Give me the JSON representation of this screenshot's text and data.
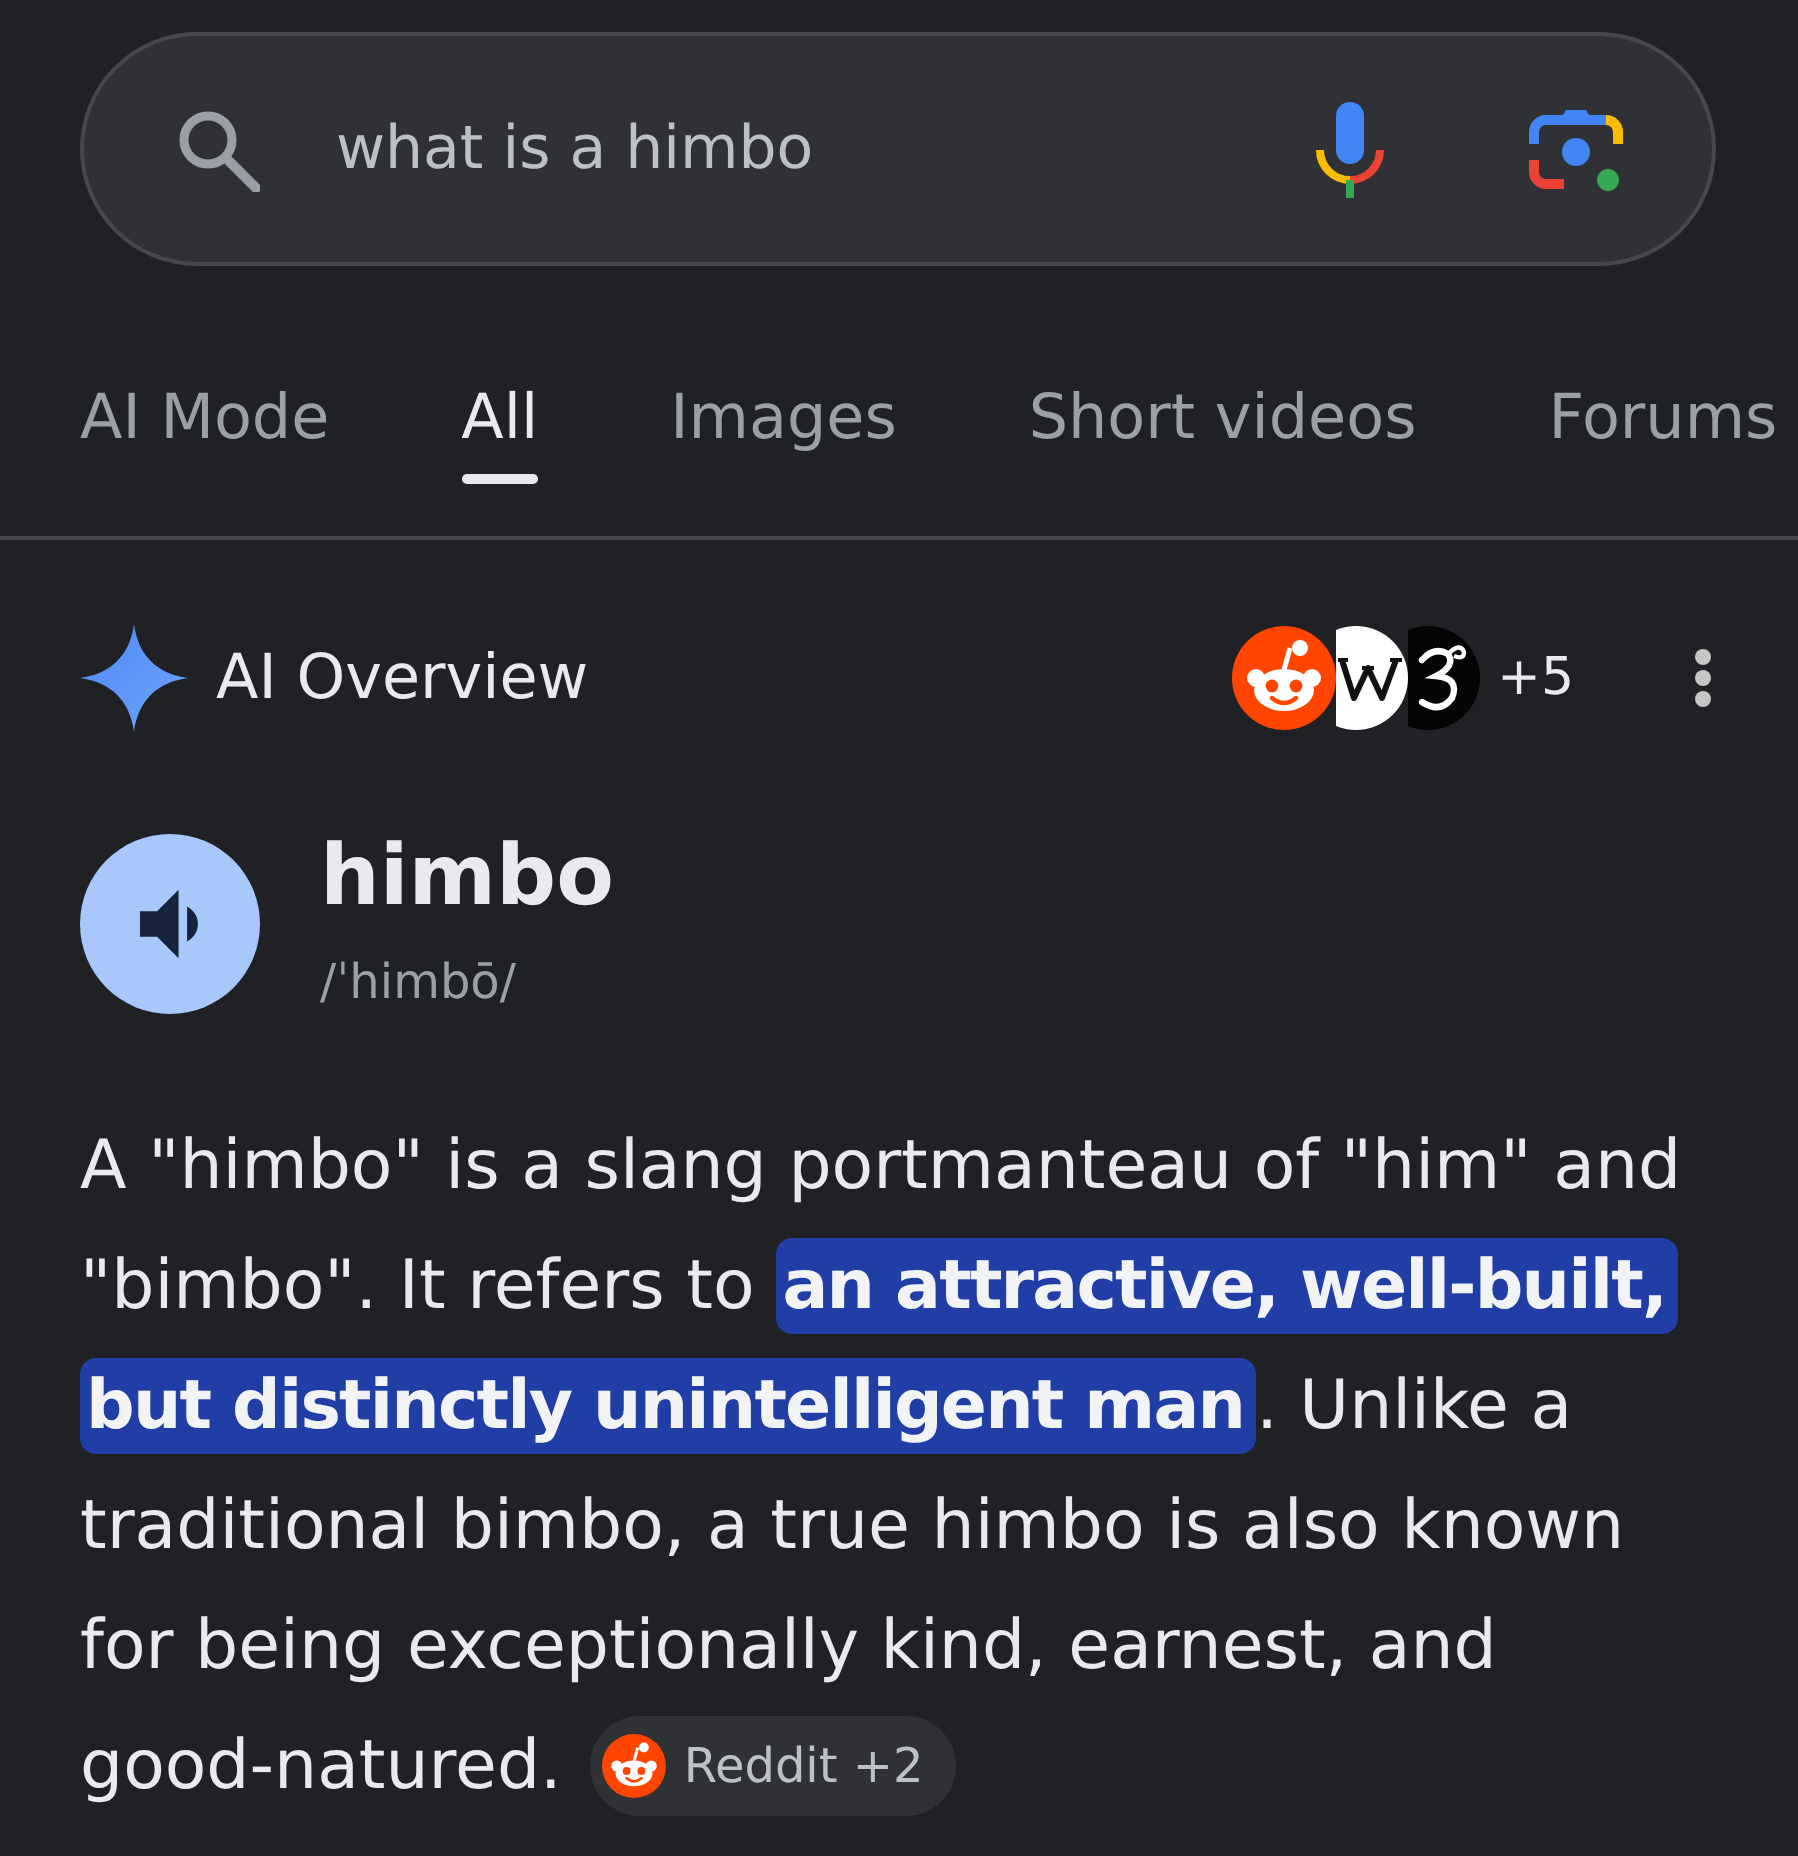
{
  "search": {
    "value": "what is a himbo"
  },
  "tabs": [
    {
      "label": "AI Mode",
      "selected": false
    },
    {
      "label": "All",
      "selected": true
    },
    {
      "label": "Images",
      "selected": false
    },
    {
      "label": "Short videos",
      "selected": false
    },
    {
      "label": "Forums",
      "selected": false
    }
  ],
  "ai_overview": {
    "title": "AI Overview",
    "more_sources": "+5",
    "term": {
      "word": "himbo",
      "pronunciation": "/ˈhimbō/"
    },
    "summary_lines": [
      {
        "segments": [
          {
            "text": "A \"himbo\" is a slang portmanteau of \"him\" and",
            "highlighted": false
          }
        ]
      },
      {
        "segments": [
          {
            "text": "\"bimbo\". It refers to",
            "highlighted": false
          },
          {
            "text": "an attractive, well-built,",
            "highlighted": true
          }
        ]
      },
      {
        "segments": [
          {
            "text": "but distinctly unintelligent man",
            "highlighted": true
          },
          {
            "text": ". Unlike a",
            "highlighted": false
          }
        ]
      },
      {
        "segments": [
          {
            "text": "traditional bimbo, a true himbo is also known",
            "highlighted": false
          }
        ]
      },
      {
        "segments": [
          {
            "text": "for being exceptionally kind, earnest, and",
            "highlighted": false
          }
        ]
      },
      {
        "segments": [
          {
            "text": "good-natured.",
            "highlighted": false
          }
        ]
      }
    ],
    "citation": {
      "label": "Reddit +2"
    }
  }
}
